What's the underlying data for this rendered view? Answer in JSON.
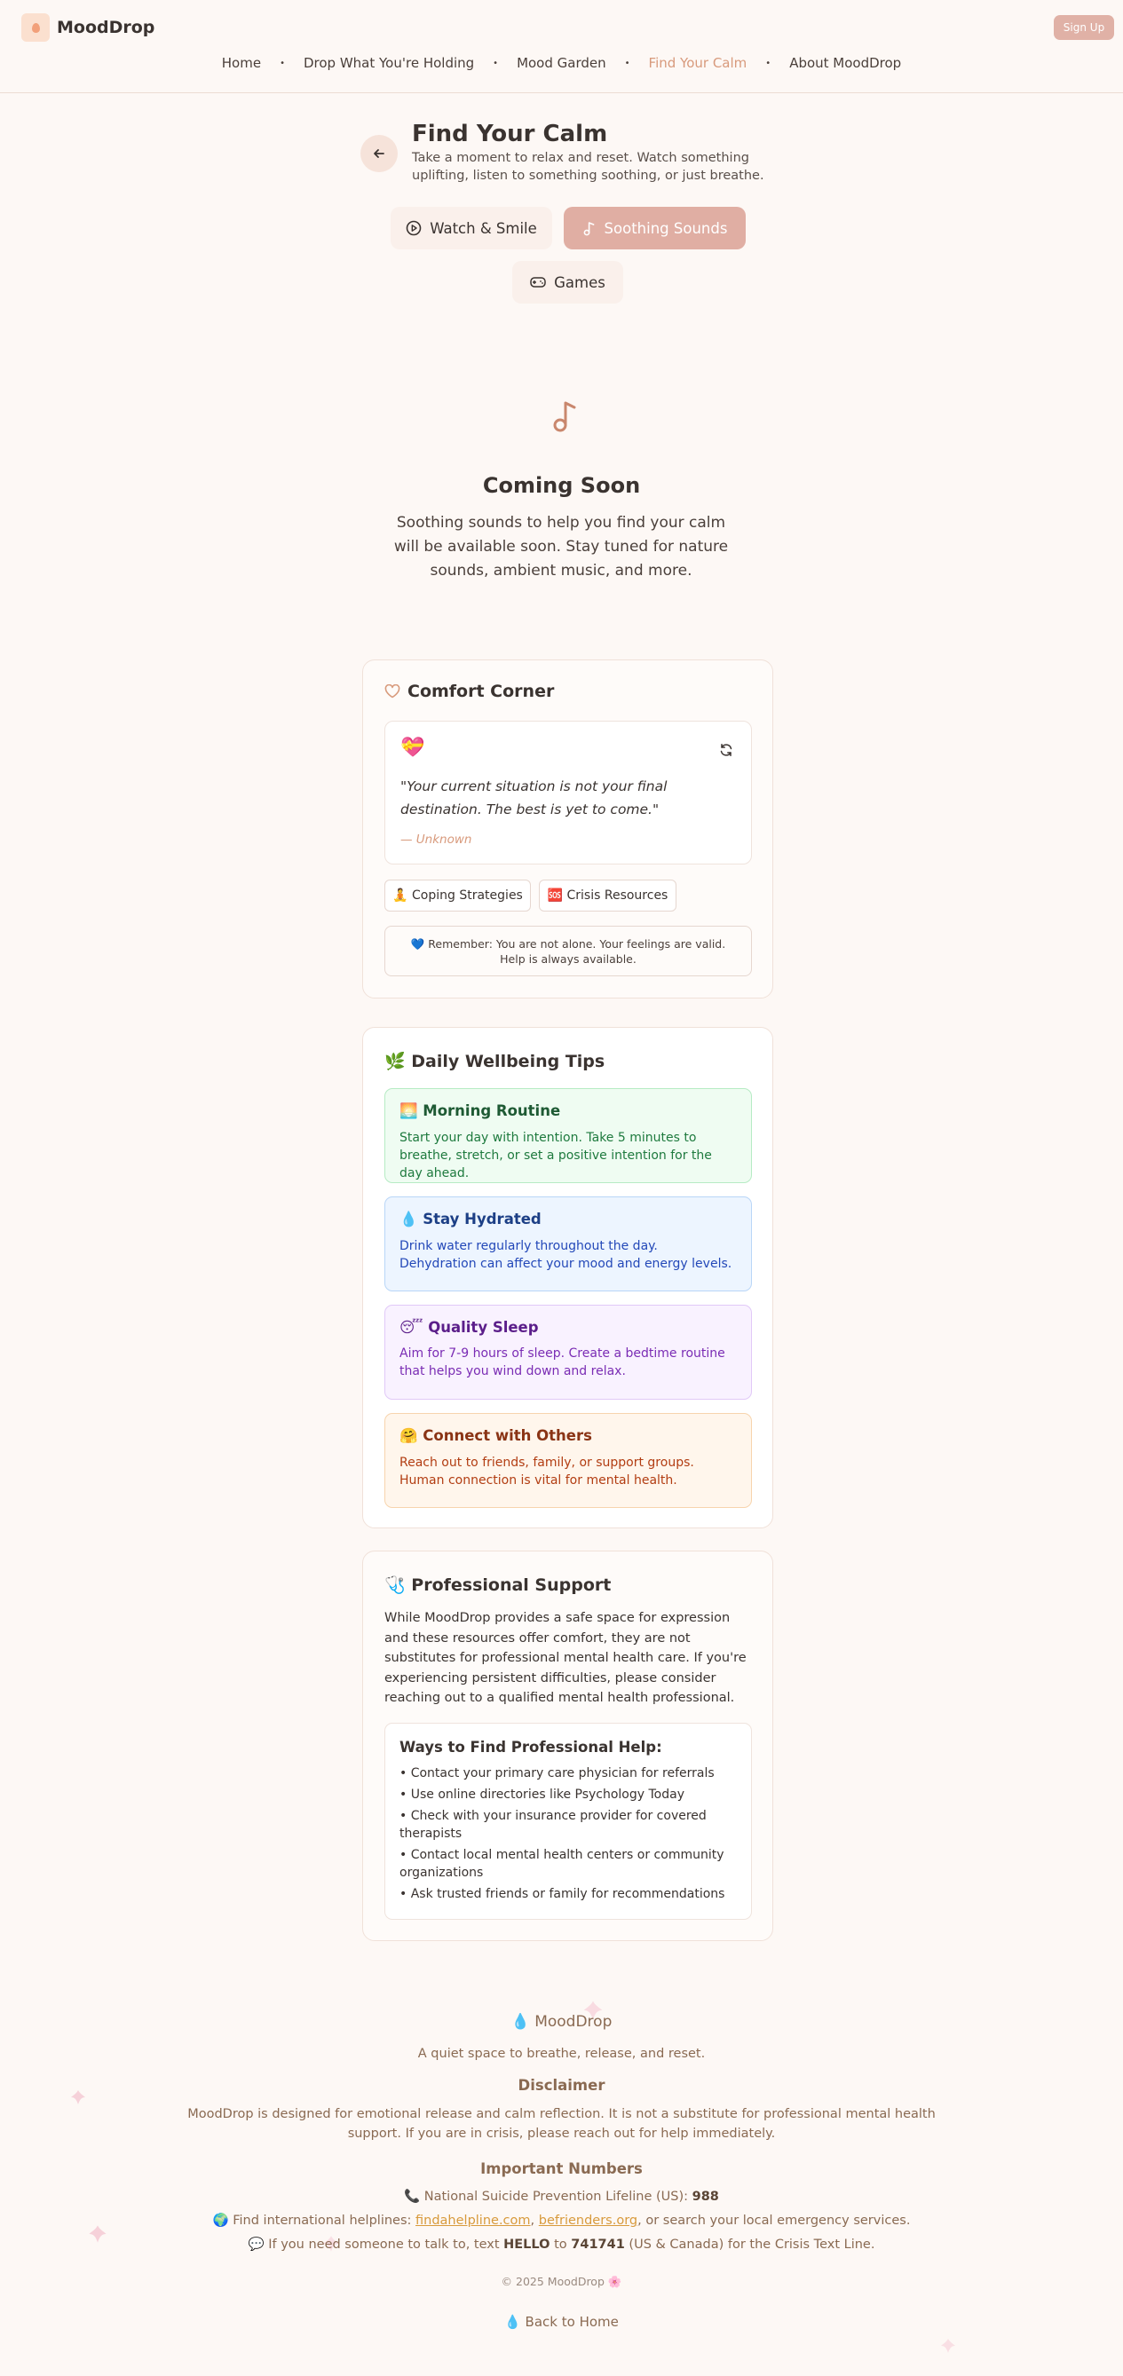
{
  "header": {
    "brand": "MoodDrop",
    "signup": "Sign Up",
    "nav": [
      "Home",
      "Drop What You're Holding",
      "Mood Garden",
      "Find Your Calm",
      "About MoodDrop"
    ],
    "active_nav": "Find Your Calm"
  },
  "page": {
    "title": "Find Your Calm",
    "subtitle": "Take a moment to relax and reset. Watch something uplifting, listen to something soothing, or just breathe.",
    "tabs": [
      "Watch & Smile",
      "Soothing Sounds",
      "Games"
    ],
    "active_tab": "Soothing Sounds"
  },
  "coming_soon": {
    "title": "Coming Soon",
    "text": "Soothing sounds to help you find your calm will be available soon. Stay tuned for nature sounds, ambient music, and more."
  },
  "comfort": {
    "title": "Comfort Corner",
    "emoji": "💝",
    "quote": "\"Your current situation is not your final destination. The best is yet to come.\"",
    "author": "— Unknown",
    "chips": [
      "🧘 Coping Strategies",
      "🆘 Crisis Resources"
    ],
    "remember": "💙 Remember: You are not alone. Your feelings are valid. Help is always available."
  },
  "tips": {
    "title": "🌿 Daily Wellbeing Tips",
    "items": [
      {
        "title": "🌅 Morning Routine",
        "desc": "Start your day with intention. Take 5 minutes to breathe, stretch, or set a positive intention for the day ahead."
      },
      {
        "title": "💧 Stay Hydrated",
        "desc": "Drink water regularly throughout the day. Dehydration can affect your mood and energy levels."
      },
      {
        "title": "😴 Quality Sleep",
        "desc": "Aim for 7-9 hours of sleep. Create a bedtime routine that helps you wind down and relax."
      },
      {
        "title": "🤗 Connect with Others",
        "desc": "Reach out to friends, family, or support groups. Human connection is vital for mental health."
      }
    ]
  },
  "pro": {
    "title": "🩺 Professional Support",
    "text": "While MoodDrop provides a safe space for expression and these resources offer comfort, they are not substitutes for professional mental health care. If you're experiencing persistent difficulties, please consider reaching out to a qualified mental health professional.",
    "ways_title": "Ways to Find Professional Help:",
    "ways": [
      "• Contact your primary care physician for referrals",
      "• Use online directories like Psychology Today",
      "• Check with your insurance provider for covered therapists",
      "• Contact local mental health centers or community organizations",
      "• Ask trusted friends or family for recommendations"
    ]
  },
  "footer": {
    "brand": "💧 MoodDrop",
    "tagline": "A quiet space to breathe, release, and reset.",
    "disclaimer_title": "Disclaimer",
    "disclaimer": "MoodDrop is designed for emotional release and calm reflection. It is not a substitute for professional mental health support. If you are in crisis, please reach out for help immediately.",
    "numbers_title": "Important Numbers",
    "lifeline_prefix": "📞 National Suicide Prevention Lifeline (US): ",
    "lifeline_number": "988",
    "intl_prefix": "🌍 Find international helplines: ",
    "intl_link1": "findahelpline.com",
    "intl_sep": ", ",
    "intl_link2": "befrienders.org",
    "intl_suffix": ", or search your local emergency services.",
    "text_prefix": "💬 If you need someone to talk to, text ",
    "text_word": "HELLO",
    "text_mid": " to ",
    "text_number": "741741",
    "text_suffix": " (US & Canada) for the Crisis Text Line.",
    "copyright": "© 2025 MoodDrop 🌸",
    "back_home": "💧 Back to Home"
  },
  "colors": {
    "background": "#fdf8f5",
    "accent": "#e0aea3",
    "active_nav": "#d89a7c",
    "footer_text": "#8a6a52"
  },
  "icons": [
    "back-arrow-icon",
    "play-circle-icon",
    "music-note-icon",
    "gamepad-icon",
    "heart-icon",
    "refresh-icon"
  ]
}
